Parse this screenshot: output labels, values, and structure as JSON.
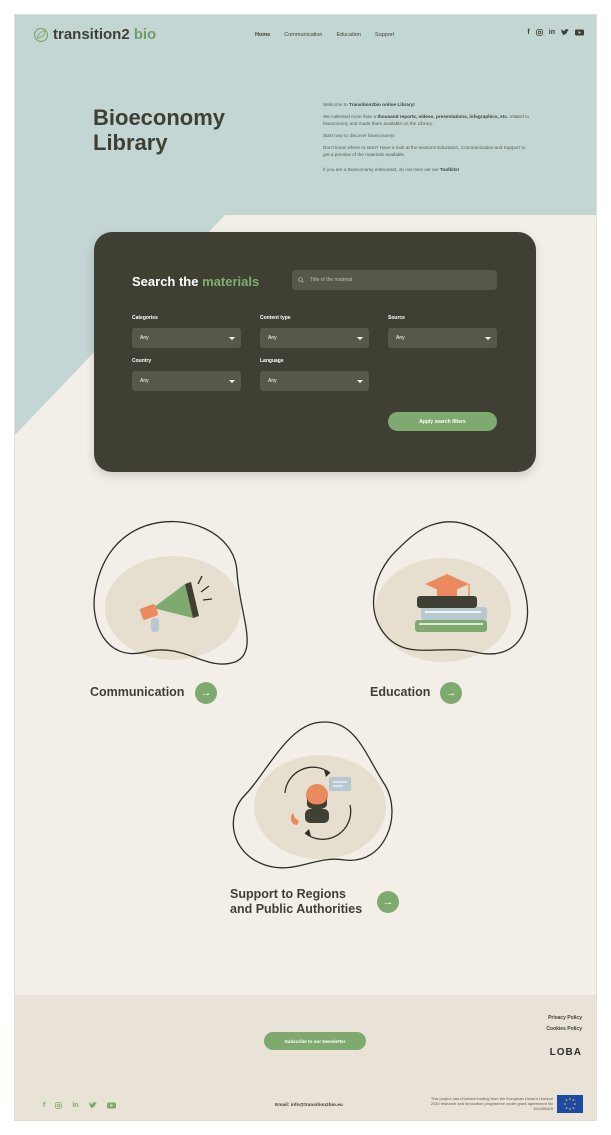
{
  "nav": {
    "logo_main": "transition2",
    "logo_accent": "bio",
    "links": [
      "Home",
      "Communication",
      "Education",
      "Support"
    ],
    "social": [
      "f",
      "ig",
      "in",
      "tw",
      "yt"
    ]
  },
  "hero": {
    "title": "Bioeconomy Library",
    "p1_pre": "Welcome to ",
    "p1_bold": "Transition2bio online Library!",
    "p2_pre": "We collected more than a ",
    "p2_bold1": "thousand reports, videos, presentations, infographics, etc.",
    "p2_post": " related to bioeconomy and made them available on the Library.",
    "p3": "Start now to discover bioeconomy!",
    "p4": "Don't know where to start? Have a look at the sections Education, Communication and Support to get a preview of the materials available.",
    "p5_pre": "If you are a Bioeconomy enthusiast, do not miss out our ",
    "p5_bold": "Toolkits!"
  },
  "search": {
    "title_main": "Search the ",
    "title_accent": "materials",
    "placeholder": "Title of the material",
    "filters": {
      "categories": {
        "label": "Categories",
        "value": "Any"
      },
      "content_type": {
        "label": "Content type",
        "value": "Any"
      },
      "source": {
        "label": "Source",
        "value": "Any"
      },
      "country": {
        "label": "Country",
        "value": "Any"
      },
      "language": {
        "label": "Language",
        "value": "Any"
      }
    },
    "apply_label": "Apply search filters"
  },
  "categories": {
    "communication": "Communication",
    "education": "Education",
    "support_line1": "Support to Regions",
    "support_line2": "and Public Authorities",
    "arrow": "→"
  },
  "footer": {
    "newsletter": "Subscribe to our Newsletter",
    "privacy": "Privacy Policy",
    "cookies": "Cookies Policy",
    "loba": "LOBA",
    "email": "Email: info@transition2bio.eu",
    "funding": "This project has received funding from the European Union's Horizon 2020 research and innovation programme under grant agreement No 101006529",
    "social": [
      "f",
      "ig",
      "in",
      "tw",
      "yt"
    ]
  },
  "colors": {
    "accent_green": "#7faa6f",
    "dark_olive": "#3f3f33",
    "hero_blue": "#c4d6d3",
    "beige": "#f3efe8"
  }
}
